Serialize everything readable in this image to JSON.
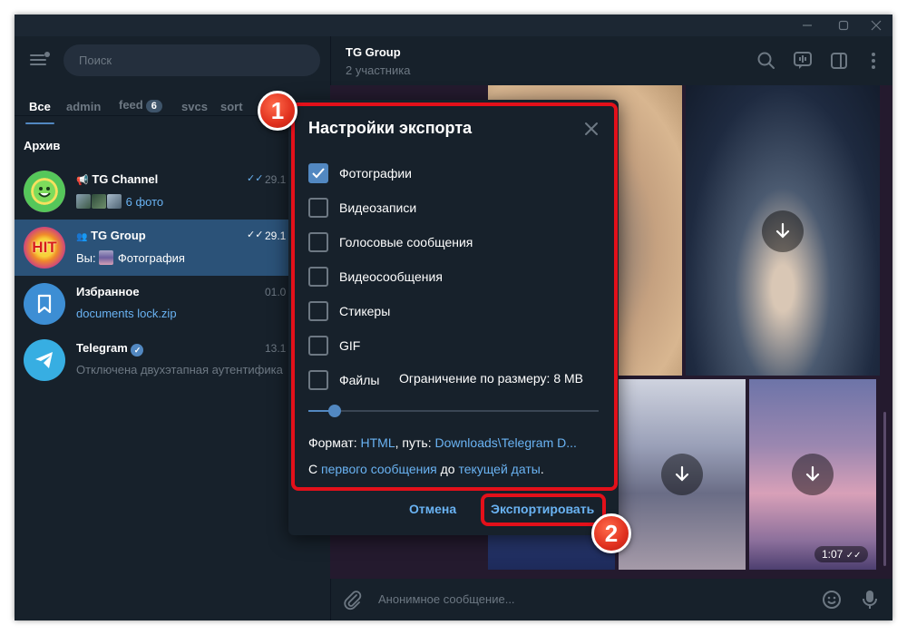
{
  "sidebar": {
    "search_placeholder": "Поиск",
    "folders": [
      {
        "label": "Все",
        "active": true
      },
      {
        "label": "admin"
      },
      {
        "label": "feed",
        "badge": "6"
      },
      {
        "label": "svcs"
      },
      {
        "label": "sort"
      }
    ],
    "archive_label": "Архив",
    "chats": [
      {
        "title": "TG Channel",
        "time": "29.1",
        "preview": "6 фото"
      },
      {
        "title": "TG Group",
        "time": "29.1",
        "preview_prefix": "Вы:",
        "preview": "Фотография"
      },
      {
        "title": "Избранное",
        "time": "01.0",
        "preview": "documents lock.zip"
      },
      {
        "title": "Telegram",
        "time": "13.1",
        "preview": "Отключена двухэтапная аутентифика"
      }
    ]
  },
  "header": {
    "title": "TG Group",
    "subtitle": "2 участника"
  },
  "chat": {
    "video_duration": "1:07",
    "input_placeholder": "Анонимное сообщение..."
  },
  "dialog": {
    "title": "Настройки экспорта",
    "options": [
      {
        "label": "Фотографии",
        "checked": true
      },
      {
        "label": "Видеозаписи",
        "checked": false
      },
      {
        "label": "Голосовые сообщения",
        "checked": false
      },
      {
        "label": "Видеосообщения",
        "checked": false
      },
      {
        "label": "Стикеры",
        "checked": false
      },
      {
        "label": "GIF",
        "checked": false
      },
      {
        "label": "Файлы",
        "checked": false
      }
    ],
    "size_limit": "Ограничение по размеру: 8 MB",
    "size_slider_fraction": 0.09,
    "format_prefix": "Формат:",
    "format_value": "HTML",
    "path_prefix": ", путь:",
    "path_value": "Downloads\\Telegram D...",
    "range_from": "С",
    "range_from_link": "первого сообщения",
    "range_to": "до",
    "range_to_link": "текущей даты",
    "range_end": ".",
    "cancel_label": "Отмена",
    "export_label": "Экспортировать"
  },
  "annotations": {
    "marker_1": "1",
    "marker_2": "2",
    "highlight_color": "#e3101a"
  },
  "colors": {
    "accent": "#5288c1",
    "link": "#6ab3f3",
    "background": "#17212b"
  }
}
